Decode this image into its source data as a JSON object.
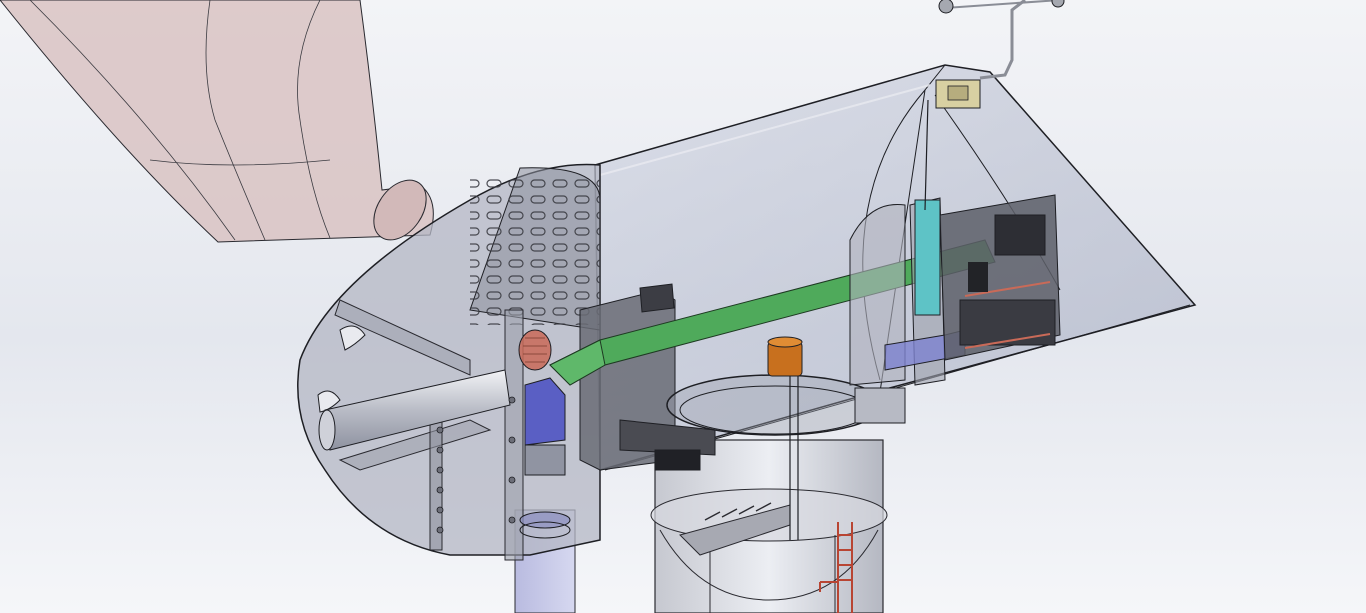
{
  "viewport": {
    "background_top": "#f3f4f7",
    "background_mid": "#e4e7ee",
    "background_bottom": "#f5f6f9"
  },
  "colors": {
    "housing_glass": "#aab0c4",
    "housing_edge": "#1e1f24",
    "blade": "#d9c3c3",
    "main_shaft": "#4faa5b",
    "gearbox_green": "#5fb86a",
    "motor_blue": "#5a5fc4",
    "yaw_orange": "#c8701e",
    "cyan_coupling": "#5ec3c6",
    "panel_beige": "#d8d0a2",
    "red_brake": "#c96a58",
    "dark_machinery": "#4a4b52",
    "ladder_red": "#b84533"
  },
  "components": [
    {
      "name": "rotor-blade",
      "icon": "blade-shape"
    },
    {
      "name": "nose-cone",
      "icon": "spinner-shape"
    },
    {
      "name": "low-speed-shaft",
      "icon": "shaft-shape"
    },
    {
      "name": "main-bearing",
      "icon": "bearing-shape"
    },
    {
      "name": "gearbox",
      "icon": "gear-shape"
    },
    {
      "name": "generator",
      "icon": "generator-shape"
    },
    {
      "name": "yaw-drive",
      "icon": "yaw-shape"
    },
    {
      "name": "anemometer",
      "icon": "wind-sensor-shape"
    },
    {
      "name": "controller-cabinet",
      "icon": "cabinet-shape"
    },
    {
      "name": "tower",
      "icon": "tower-shape"
    },
    {
      "name": "access-ladder",
      "icon": "ladder-shape"
    }
  ]
}
